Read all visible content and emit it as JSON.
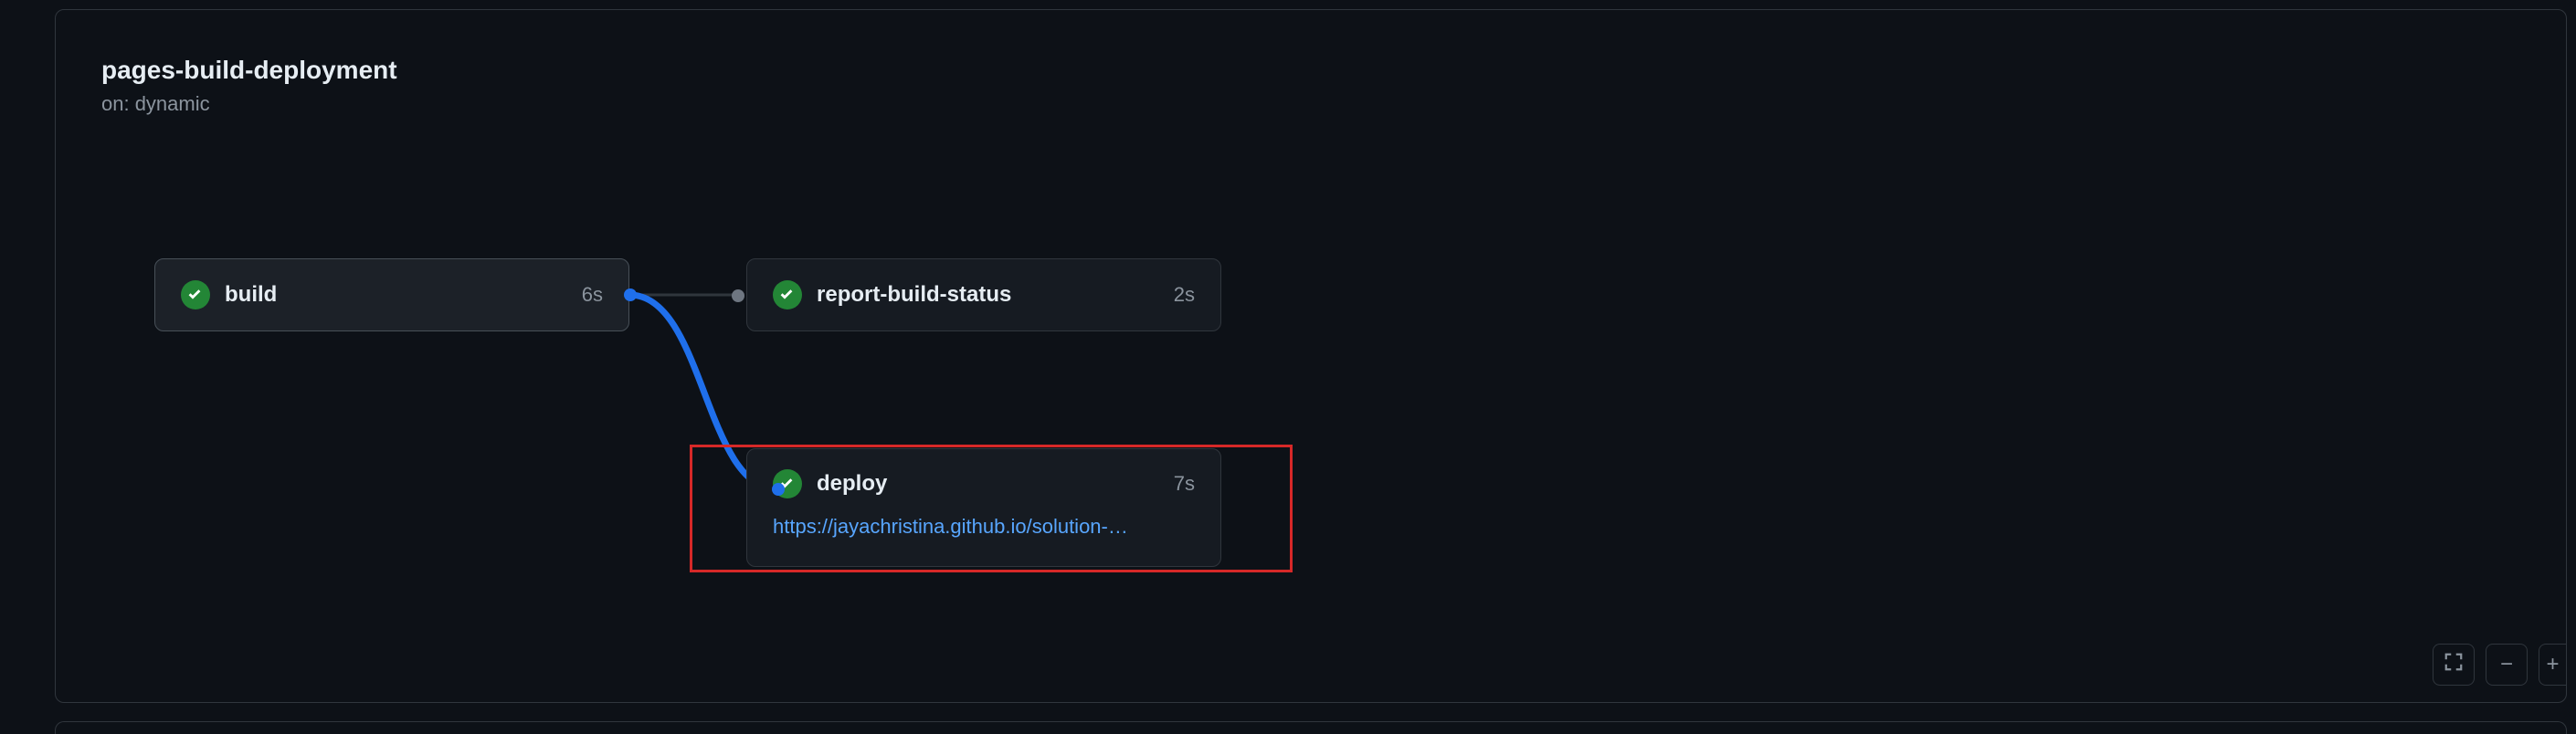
{
  "workflow": {
    "title": "pages-build-deployment",
    "trigger": "on: dynamic"
  },
  "jobs": {
    "build": {
      "name": "build",
      "duration": "6s",
      "status": "success"
    },
    "report": {
      "name": "report-build-status",
      "duration": "2s",
      "status": "success"
    },
    "deploy": {
      "name": "deploy",
      "duration": "7s",
      "status": "success",
      "url": "https://jayachristina.github.io/solution-…"
    }
  },
  "colors": {
    "panel_border": "#30363d",
    "success": "#238636",
    "link": "#58a6ff",
    "line": "#1f6feb",
    "highlight": "#d62828"
  },
  "toolbar": {
    "fullscreen": "fullscreen",
    "zoom_out": "−",
    "zoom_in": "+"
  }
}
